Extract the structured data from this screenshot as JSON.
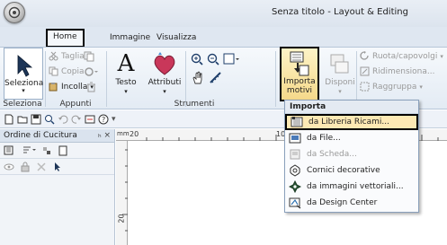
{
  "window": {
    "title": "Senza titolo - Layout & Editing"
  },
  "tabs": [
    {
      "label": "Home"
    },
    {
      "label": "Immagine"
    },
    {
      "label": "Visualizza"
    }
  ],
  "ribbon": {
    "seleziona": {
      "label": "Seleziona",
      "group": "Seleziona"
    },
    "appunti": {
      "taglia": "Taglia",
      "copia": "Copia",
      "incolla": "Incolla",
      "group": "Appunti"
    },
    "strumenti": {
      "testo": "Testo",
      "attributi": "Attributi",
      "group": "Strumenti"
    },
    "importa": {
      "label_line1": "Importa",
      "label_line2": "motivi"
    },
    "disponi": {
      "label": "Disponi"
    },
    "trasforma": {
      "ruota": "Ruota/capovolgi",
      "ridimensiona": "Ridimensiona...",
      "raggruppa": "Raggruppa"
    }
  },
  "panel": {
    "title": "Ordine di Cucitura",
    "controls": "ₕ ×"
  },
  "ruler": {
    "top_20": "20",
    "top_10": "10",
    "left_20": "20",
    "corner": "mm"
  },
  "dropdown": {
    "header": "Importa",
    "items": [
      {
        "label": "da Libreria Ricami...",
        "icon": "library-icon",
        "enabled": true,
        "highlighted": true
      },
      {
        "label": "da File...",
        "icon": "file-icon",
        "enabled": true,
        "highlighted": false
      },
      {
        "label": "da Scheda...",
        "icon": "card-icon",
        "enabled": false,
        "highlighted": false
      },
      {
        "label": "Cornici decorative",
        "icon": "frame-icon",
        "enabled": true,
        "highlighted": false
      },
      {
        "label": "da immagini vettoriali...",
        "icon": "vector-icon",
        "enabled": true,
        "highlighted": false
      },
      {
        "label": "da Design Center",
        "icon": "design-center-icon",
        "enabled": true,
        "highlighted": false
      }
    ]
  }
}
